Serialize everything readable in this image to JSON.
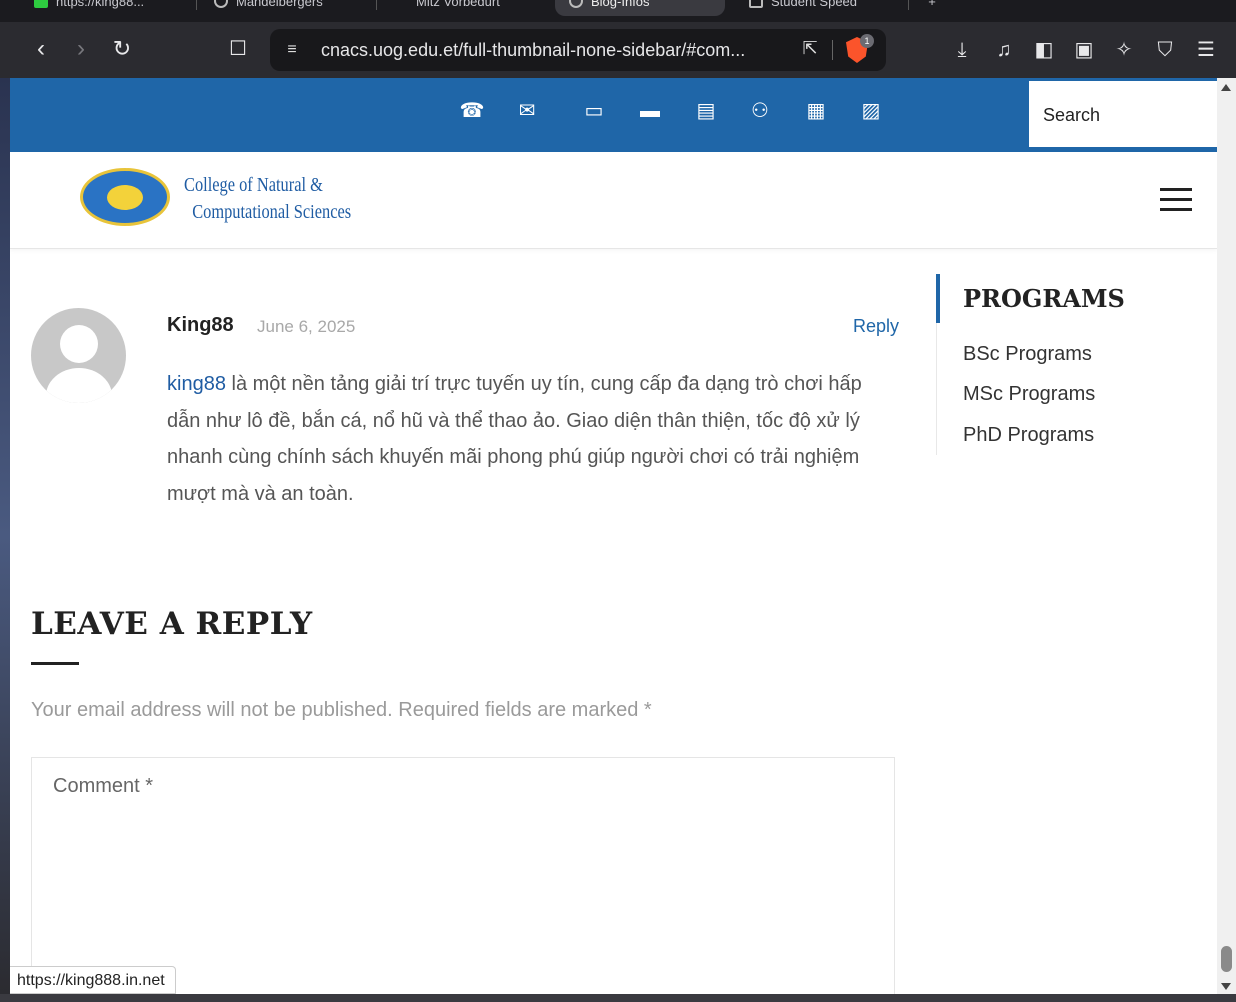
{
  "browser": {
    "tabs": [
      {
        "label": "https://king88..."
      },
      {
        "label": "Mandelbergers"
      },
      {
        "label": "Mitz Vorbedurt"
      },
      {
        "label": "Blog-Infos"
      },
      {
        "label": "Student Speed"
      }
    ],
    "url": "cnacs.uog.edu.et/full-thumbnail-none-sidebar/#com...",
    "shield_badge": "1",
    "status_url": "https://king888.in.net"
  },
  "site": {
    "search_label": "Search",
    "logo_line1": "College of Natural &",
    "logo_line2": "Computational Sciences",
    "topbar_icons": [
      "phone-icon",
      "mail-check-icon",
      "monitor-icon",
      "id-card-icon",
      "news-icon",
      "users-icon",
      "calendar-icon",
      "chat-icon"
    ]
  },
  "comment": {
    "author": "King88",
    "date": "June 6, 2025",
    "reply_label": "Reply",
    "link_text": "king88",
    "body": " là một nền tảng giải trí trực tuyến uy tín, cung cấp đa dạng trò chơi hấp dẫn như lô đề, bắn cá, nổ hũ và thể thao ảo. Giao diện thân thiện, tốc độ xử lý nhanh cùng chính sách khuyến mãi phong phú giúp người chơi có trải nghiệm mượt mà và an toàn."
  },
  "reply_form": {
    "title": "LEAVE A REPLY",
    "note": "Your email address will not be published. Required fields are marked *",
    "comment_placeholder": "Comment *"
  },
  "sidebar": {
    "title": "PROGRAMS",
    "items": [
      {
        "label": "BSc Programs"
      },
      {
        "label": "MSc Programs"
      },
      {
        "label": "PhD Programs"
      }
    ]
  },
  "colors": {
    "brand_blue": "#1f66a8",
    "link_blue": "#1f5ca3"
  }
}
